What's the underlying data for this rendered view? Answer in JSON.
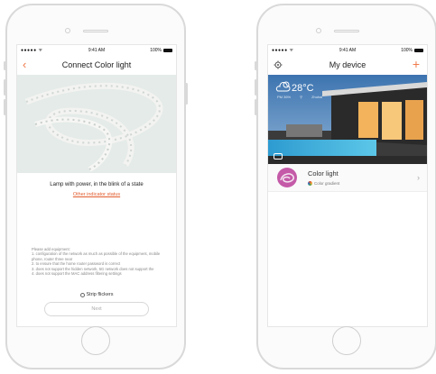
{
  "status_bar": {
    "signal": "●●●●● ᯤ",
    "time": "9:41 AM",
    "battery": "100%"
  },
  "connect_screen": {
    "title": "Connect Color light",
    "lamp_message": "Lamp with power, in the blink of a state",
    "indicator_link": "Other indicator status",
    "notes": [
      "Please add equipment:",
      "1. configuration of the network as much as possible of the equipment, mobile phone, router three near",
      "2. to ensure that the home router password is correct",
      "3. does not support the hidden network, 5G network does not support the",
      "4. does not support the MAC address filtering settings"
    ],
    "strip_option": "Strip flickers",
    "next_label": "Next"
  },
  "device_screen": {
    "title": "My device",
    "weather": {
      "temperature": "28°C",
      "humidity": "PM 36%",
      "location": "Zhuhai"
    },
    "devices": [
      {
        "name": "Color light",
        "mode": "Color gradient"
      }
    ]
  },
  "colors": {
    "accent": "#f07a4a",
    "link": "#e25c2e",
    "avatar": "#c45aa8"
  },
  "icons": [
    "back-icon",
    "gear-icon",
    "plus-icon",
    "cloud-sun-icon",
    "location-icon",
    "camera-icon",
    "gradient-icon",
    "chevron-right-icon"
  ]
}
